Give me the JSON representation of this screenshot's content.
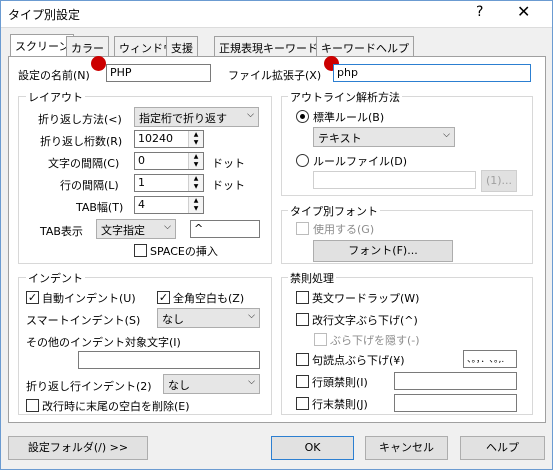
{
  "window": {
    "title": "タイプ別設定",
    "help_glyph": "?",
    "close_glyph": "✕"
  },
  "tabs": [
    "スクリーン",
    "カラー",
    "ウィンドウ",
    "支援",
    "正規表現キーワード",
    "キーワードヘルプ"
  ],
  "settings_name": {
    "label": "設定の名前(N)",
    "value": "PHP"
  },
  "file_ext": {
    "label": "ファイル拡張子(X)",
    "value": "php"
  },
  "layout": {
    "title": "レイアウト",
    "wrap_method": {
      "label": "折り返し方法(<)",
      "value": "指定桁で折り返す"
    },
    "wrap_columns": {
      "label": "折り返し桁数(R)",
      "value": "10240"
    },
    "char_spacing": {
      "label": "文字の間隔(C)",
      "value": "0",
      "unit": "ドット"
    },
    "line_spacing": {
      "label": "行の間隔(L)",
      "value": "1",
      "unit": "ドット"
    },
    "tab_width": {
      "label": "TAB幅(T)",
      "value": "4"
    },
    "tab_display": {
      "label": "TAB表示",
      "value": "文字指定",
      "char": "^"
    },
    "space_insert": {
      "label": "SPACEの挿入",
      "checked": false
    }
  },
  "outline": {
    "title": "アウトライン解析方法",
    "standard_rule": {
      "label": "標準ルール(B)",
      "selected": true,
      "value": "テキスト"
    },
    "rule_file": {
      "label": "ルールファイル(D)",
      "selected": false,
      "value": "",
      "browse": "(1)..."
    }
  },
  "type_font": {
    "title": "タイプ別フォント",
    "use": {
      "label": "使用する(G)",
      "checked": false
    },
    "font_button": "フォント(F)..."
  },
  "indent": {
    "title": "インデント",
    "auto_indent": {
      "label": "自動インデント(U)",
      "checked": true
    },
    "fullwidth_space": {
      "label": "全角空白も(Z)",
      "checked": true
    },
    "smart_indent": {
      "label": "スマートインデント(S)",
      "value": "なし"
    },
    "other_chars_label": "その他のインデント対象文字(I)",
    "other_chars_value": "",
    "wrap_indent": {
      "label": "折り返し行インデント(2)",
      "value": "なし"
    },
    "trim_trailing": {
      "label": "改行時に末尾の空白を削除(E)",
      "checked": false
    }
  },
  "kinsoku": {
    "title": "禁則処理",
    "english_wrap": {
      "label": "英文ワードラップ(W)",
      "checked": false
    },
    "newline_hang": {
      "label": "改行文字ぶら下げ(^)",
      "checked": false
    },
    "hide_hang": {
      "label": "ぶら下げを隠す(-)",
      "checked": false
    },
    "punct_hang": {
      "label": "句読点ぶら下げ(¥)",
      "checked": false,
      "value": "、。，．､｡,."
    },
    "line_head": {
      "label": "行頭禁則(I)",
      "checked": false,
      "value": ""
    },
    "line_end": {
      "label": "行末禁則(J)",
      "checked": false,
      "value": ""
    }
  },
  "footer": {
    "settings_folder": "設定フォルダ(/) >>",
    "ok": "OK",
    "cancel": "キャンセル",
    "help": "ヘルプ"
  },
  "colors": {
    "accent": "#2c7fd1",
    "marker": "#cc0000"
  }
}
